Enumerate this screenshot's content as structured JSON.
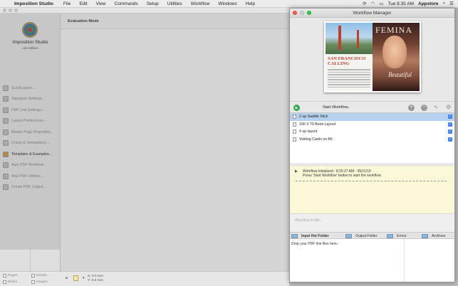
{
  "menubar": {
    "apple_glyph": "",
    "app_name": "Imposition Studio",
    "menus": [
      "File",
      "Edit",
      "View",
      "Commands",
      "Setup",
      "Utilities",
      "Workflow",
      "Windows",
      "Help"
    ],
    "clock": "Tue 8:35 AM",
    "user": "Appstore",
    "status_icons": [
      "sync-icon",
      "wifi-icon",
      "battery-icon",
      "search-icon",
      "list-icon"
    ]
  },
  "main_window": {
    "product_name": "Imposition Studio",
    "product_edition": "Lite Edition",
    "mode_label": "Evaluation Mode",
    "sidebar_items": [
      {
        "label": "QuickLayout...",
        "icon": "quicklayout-icon",
        "active": false
      },
      {
        "label": "Signature Settings...",
        "icon": "signature-icon",
        "active": false
      },
      {
        "label": "PDF Link Settings...",
        "icon": "pdf-link-icon",
        "active": false
      },
      {
        "label": "Layout Preferences...",
        "icon": "layout-prefs-icon",
        "active": false
      },
      {
        "label": "Master Page Properties...",
        "icon": "master-page-icon",
        "active": false
      },
      {
        "label": "Colors & Separations...",
        "icon": "colors-icon",
        "active": false
      },
      {
        "label": "Templates & Examples...",
        "icon": "templates-icon",
        "active": true
      },
      {
        "label": "Auto PDF Workflow...",
        "icon": "auto-pdf-icon",
        "active": false
      },
      {
        "label": "Misc PDF Utilities...",
        "icon": "misc-pdf-icon",
        "active": false
      },
      {
        "label": "Create PDF Output...",
        "icon": "create-pdf-icon",
        "active": false
      }
    ],
    "bottom_checks": {
      "pages": "Pages",
      "marks": "Marks",
      "details": "Details",
      "images": "Images"
    },
    "coords": {
      "x": "X: 0.0 mm",
      "y": "Y: 0.0 mm"
    }
  },
  "workflow_manager": {
    "title": "Workflow Manager",
    "preview": {
      "headline": "SAN FRANCISCO\nCALLING",
      "mag_title": "FEMINA",
      "cover_line": "Beautiful"
    },
    "start_label": "Start Workflow..",
    "workflows": [
      {
        "label": "2 up Saddle Stick",
        "selected": true,
        "checked": true
      },
      {
        "label": "100 X 70 Book Layout",
        "selected": false,
        "checked": true
      },
      {
        "label": "4 up layout",
        "selected": false,
        "checked": true
      },
      {
        "label": "Visiting Cards on A5",
        "selected": false,
        "checked": true
      }
    ],
    "log": {
      "line1": "Workflow Initialized  :  8:35:27 AM - 05/11/19",
      "line2": "Press 'Start Workflow' button to start the workflow."
    },
    "idle_text": "Workflow is Idle...",
    "tabs": [
      "Input Hot Folder",
      "Output Folder",
      "Errors",
      "Archives"
    ],
    "drop_text": "Drop your PDF link files here.."
  }
}
